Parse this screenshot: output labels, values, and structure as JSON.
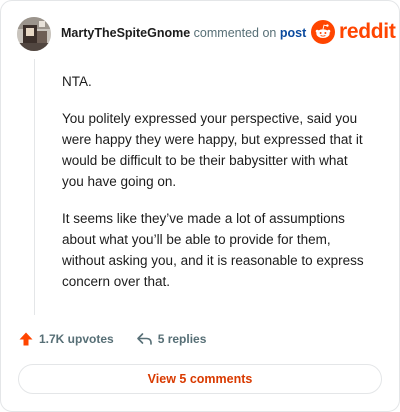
{
  "header": {
    "username": "MartyTheSpiteGnome",
    "action_text": "commented on",
    "post_link": "post",
    "logo_text": "reddit"
  },
  "comment": {
    "paragraphs": [
      "NTA.",
      "You politely expressed your perspective, said you were happy they were happy, but expressed that it would be difficult to be their babysitter with what you have going on.",
      "It seems like they’ve made a lot of assumptions about what you’ll be able to provide for them, without asking you, and it is reasonable to express concern over that."
    ]
  },
  "actions": {
    "upvotes_label": "1.7K upvotes",
    "replies_label": "5 replies"
  },
  "view_comments_label": "View 5 comments",
  "colors": {
    "brand": "#ff4500",
    "link": "#0a4a9e",
    "view_button_text": "#d93a00",
    "muted": "#576f76",
    "border": "#e4e6e8"
  },
  "icons": {
    "upvote": "upvote-arrow-icon",
    "reply": "reply-arrow-icon",
    "logo": "reddit-snoo-icon"
  }
}
